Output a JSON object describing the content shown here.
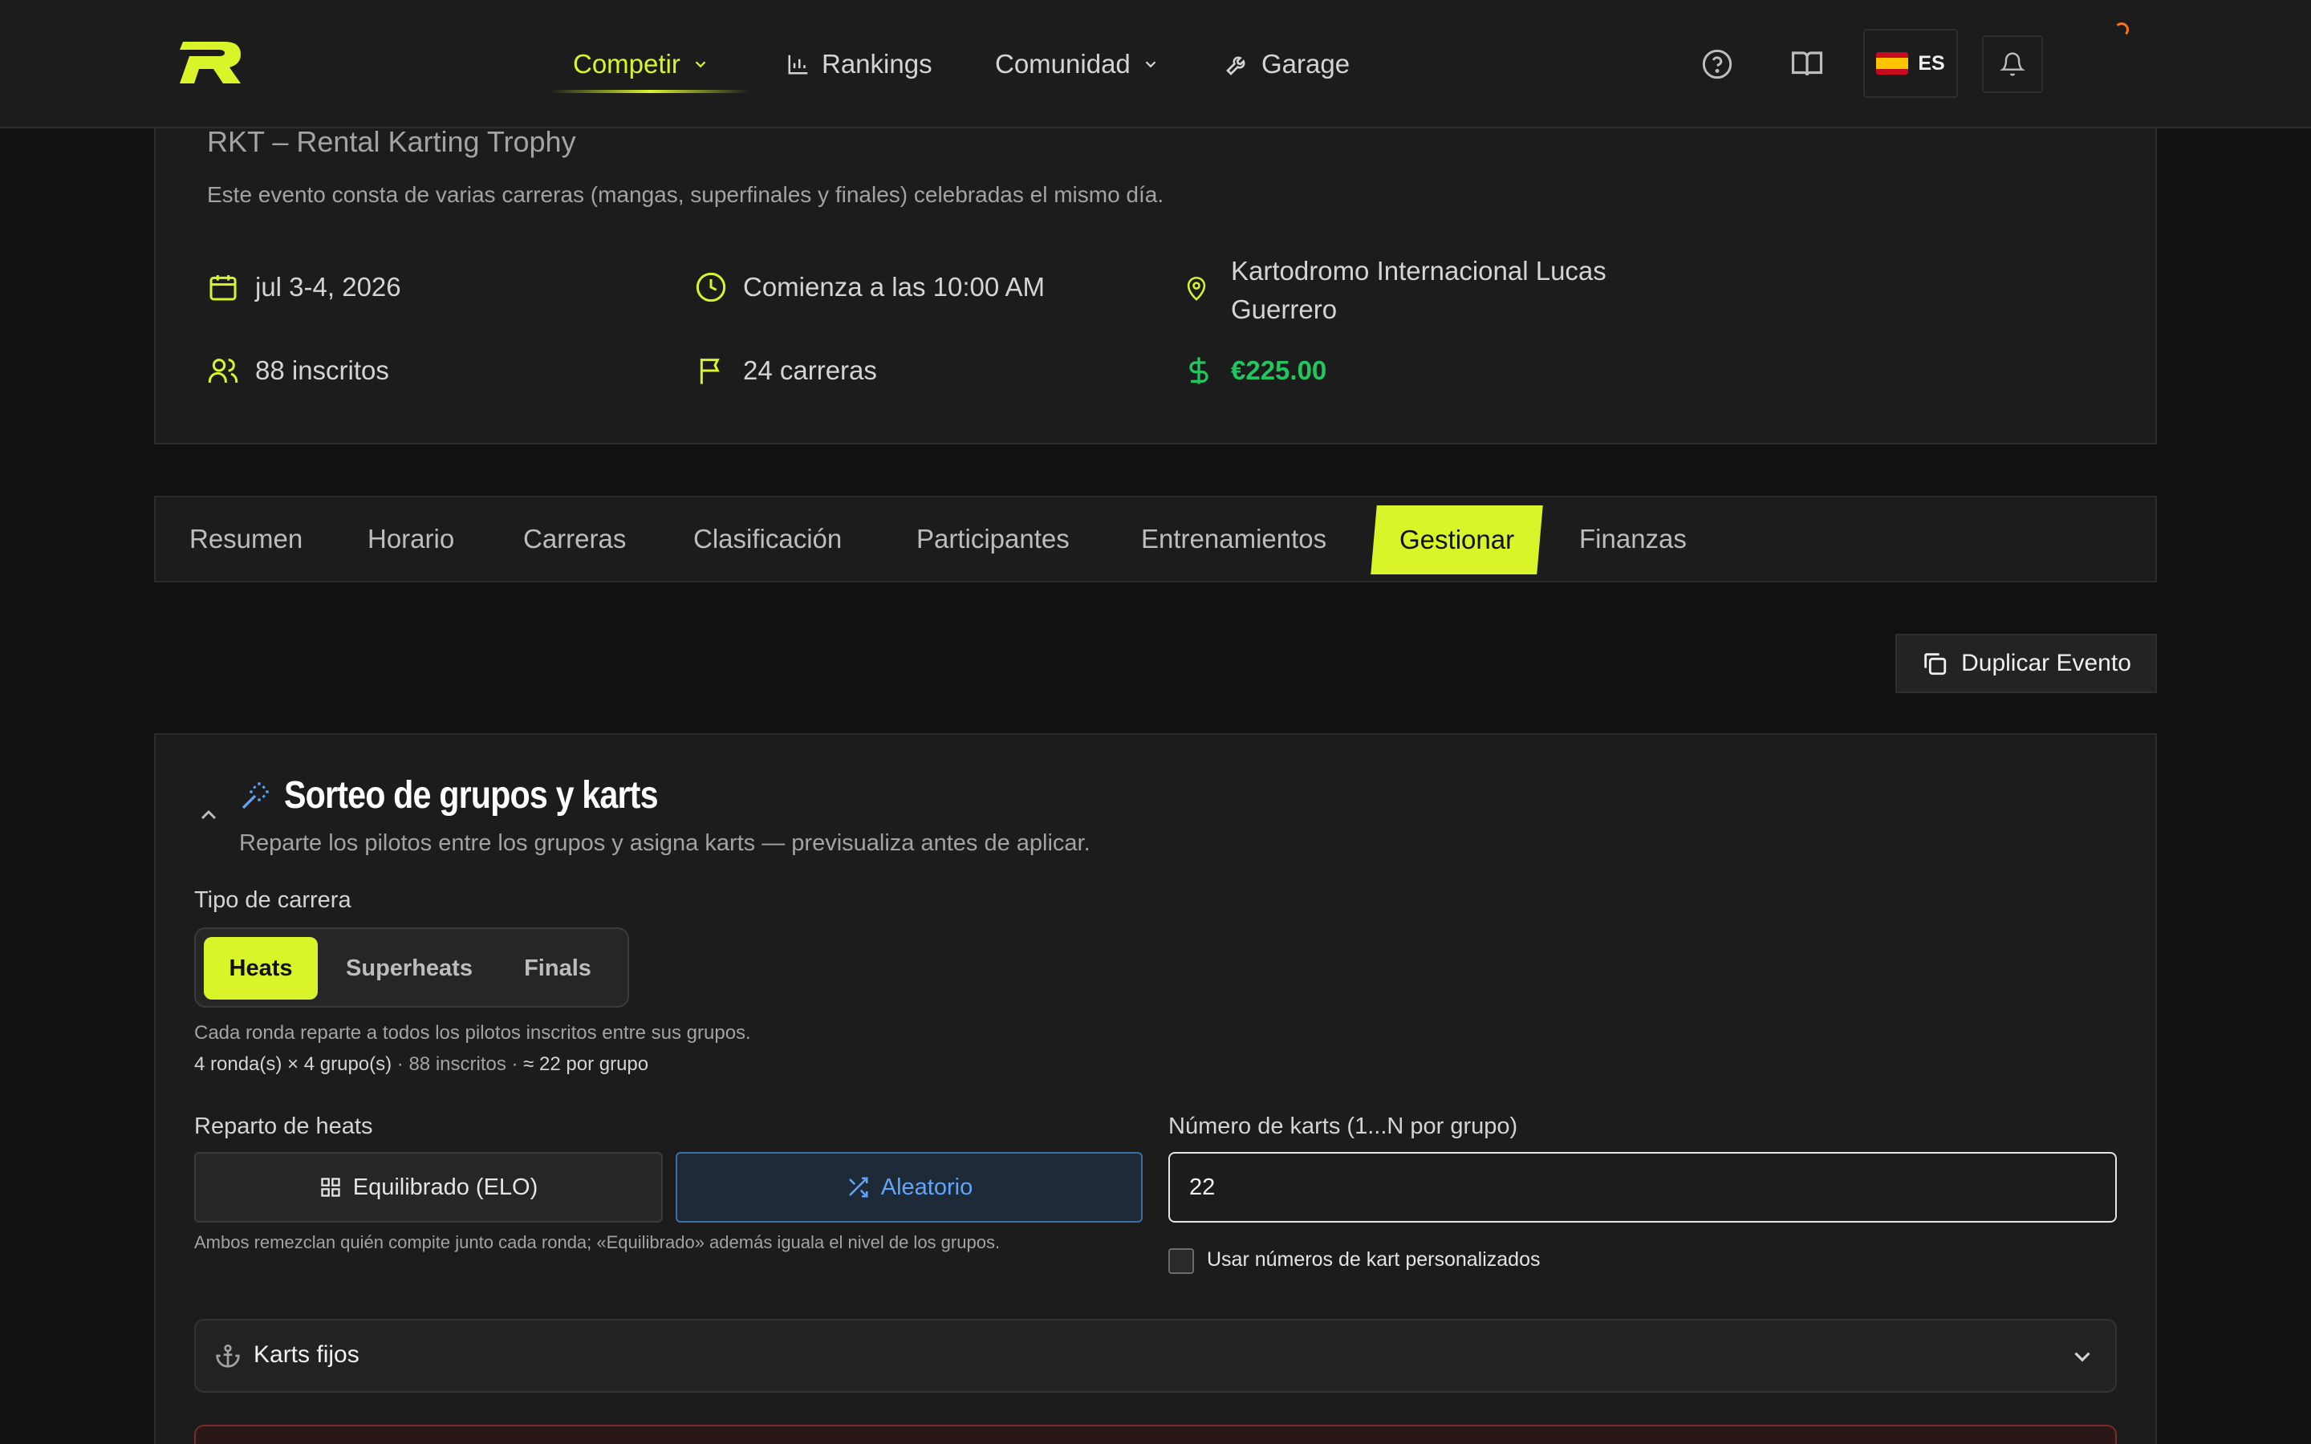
{
  "nav": {
    "items": [
      {
        "label": "Competir",
        "icon": "chevron-down-icon"
      },
      {
        "label": "Rankings",
        "icon": "bar-chart-icon"
      },
      {
        "label": "Comunidad",
        "icon": "chevron-down-icon"
      },
      {
        "label": "Garage",
        "icon": "wrench-icon"
      }
    ],
    "lang": "ES",
    "accent": "#d9f52a"
  },
  "event": {
    "title": "RKT – Rental Karting Trophy",
    "description": "Este evento consta de varias carreras (mangas, superfinales y finales) celebradas el mismo día.",
    "date": "jul 3-4, 2026",
    "start_time": "Comienza a las 10:00 AM",
    "venue_line1": "Kartodromo Internacional Lucas",
    "venue_line2": "Guerrero",
    "registered": "88 inscritos",
    "races": "24 carreras",
    "price": "€225.00",
    "price_color": "#22c55e"
  },
  "tabs": [
    "Resumen",
    "Horario",
    "Carreras",
    "Clasificación",
    "Participantes",
    "Entrenamientos",
    "Gestionar",
    "Finanzas"
  ],
  "active_tab": "Gestionar",
  "actions": {
    "duplicate_label": "Duplicar Evento"
  },
  "draw": {
    "title": "Sorteo de grupos y karts",
    "subtitle": "Reparte los pilotos entre los grupos y asigna karts — previsualiza antes de aplicar.",
    "race_type_label": "Tipo de carrera",
    "race_types": [
      "Heats",
      "Superheats",
      "Finals"
    ],
    "selected_race_type": "Heats",
    "round_note": "Cada ronda reparte a todos los pilotos inscritos entre sus grupos.",
    "summary_rounds": "4 ronda(s) × 4 grupo(s)",
    "summary_sep1": " · ",
    "summary_registered": "88 inscritos",
    "summary_sep2": " · ",
    "summary_per_group": "≈ 22 por grupo",
    "heat_split_label": "Reparto de heats",
    "split_balanced": "Equilibrado (ELO)",
    "split_random": "Aleatorio",
    "selected_split": "Aleatorio",
    "split_note": "Ambos remezclan quién compite junto cada ronda; «Equilibrado» además iguala el nivel de los grupos.",
    "karts_label": "Número de karts (1...N por grupo)",
    "karts_value": "22",
    "custom_numbers_label": "Usar números de kart personalizados",
    "custom_numbers_checked": false,
    "fixed_karts_label": "Karts fijos"
  }
}
